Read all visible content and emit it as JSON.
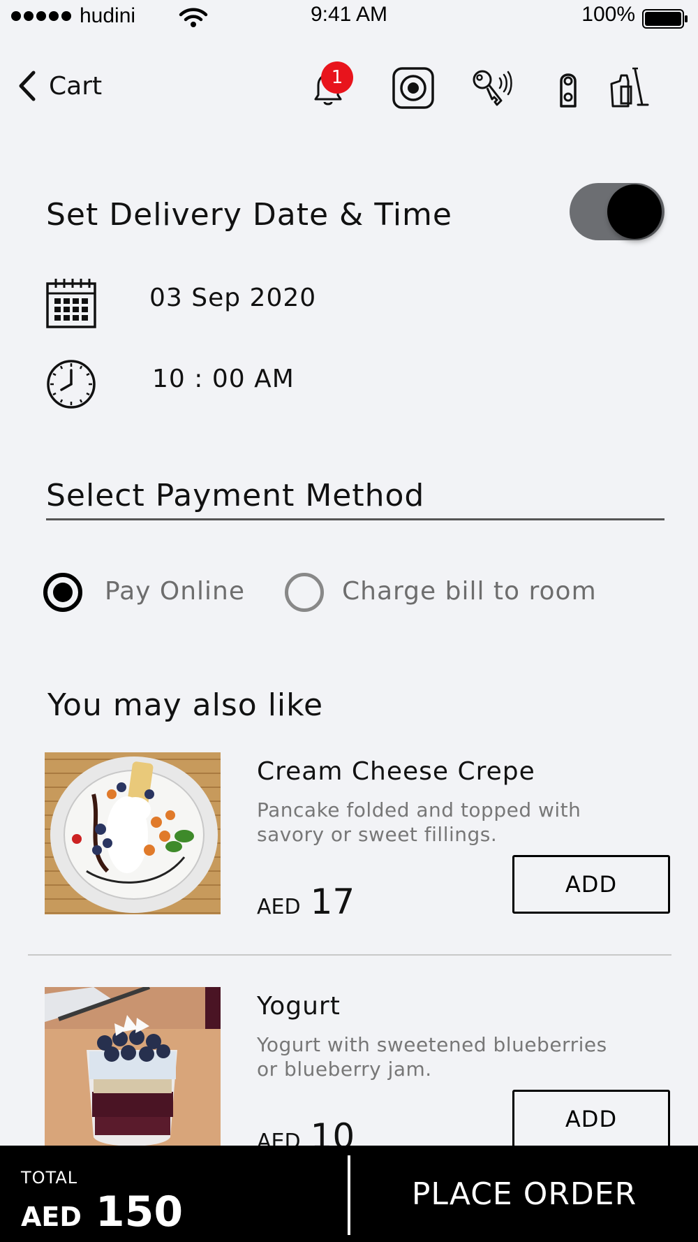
{
  "status_bar": {
    "carrier": "hudini",
    "time": "9:41 AM",
    "battery": "100%"
  },
  "nav": {
    "back_label": "Cart",
    "notification_count": "1"
  },
  "delivery": {
    "title": "Set Delivery Date & Time",
    "toggle_on": true,
    "date": "03 Sep 2020",
    "time": "10 : 00 AM"
  },
  "payment": {
    "title": "Select Payment Method",
    "options": [
      {
        "label": "Pay Online",
        "selected": true
      },
      {
        "label": "Charge bill to room",
        "selected": false
      }
    ]
  },
  "suggestions": {
    "title": "You may also like",
    "items": [
      {
        "name": "Cream Cheese Crepe",
        "description": "Pancake folded and topped with savory or sweet fillings.",
        "currency": "AED",
        "price": "17",
        "add_label": "ADD"
      },
      {
        "name": "Yogurt",
        "description": "Yogurt with sweetened blueberries or blueberry jam.",
        "currency": "AED",
        "price": "10",
        "add_label": "ADD"
      }
    ]
  },
  "footer": {
    "total_label": "TOTAL",
    "total_currency": "AED",
    "total_amount": "150",
    "place_order_label": "PLACE ORDER"
  },
  "colors": {
    "badge": "#e8141c",
    "background": "#f2f3f6",
    "toggle_track": "#6c6e72",
    "footer": "#000000"
  }
}
